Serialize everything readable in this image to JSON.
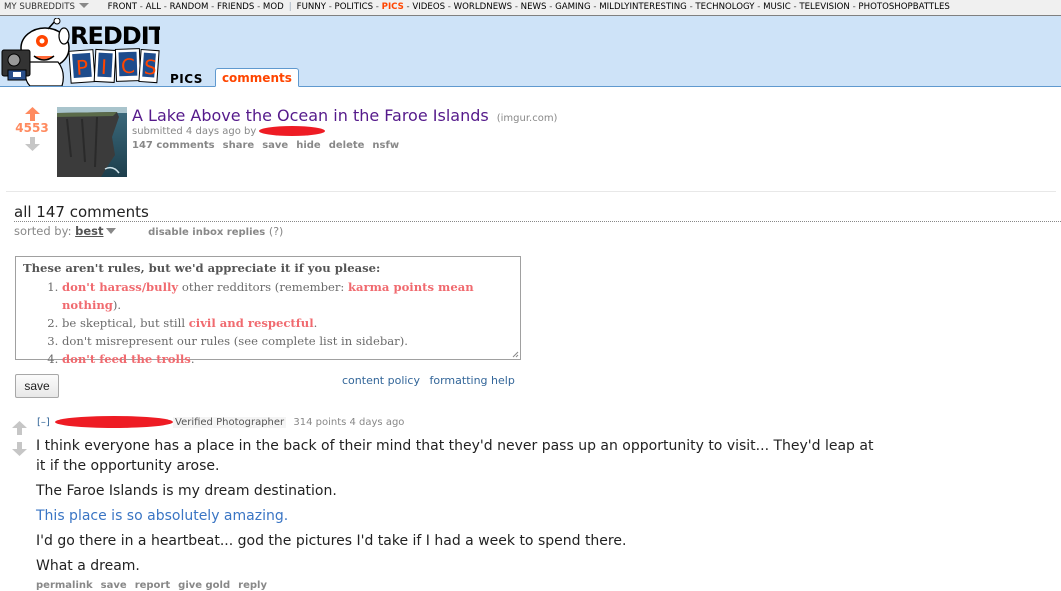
{
  "srbar": {
    "my_subreddits": "MY SUBREDDITS",
    "group1": [
      "FRONT",
      "ALL",
      "RANDOM",
      "FRIENDS",
      "MOD"
    ],
    "group2": [
      "FUNNY",
      "POLITICS",
      "PICS",
      "VIDEOS",
      "WORLDNEWS",
      "NEWS",
      "GAMING",
      "MILDLYINTERESTING",
      "TECHNOLOGY",
      "MUSIC",
      "TELEVISION",
      "PHOTOSHOPBATTLES"
    ],
    "selected": "PICS"
  },
  "header": {
    "logo_text_top": "REDDIT",
    "logo_text_bottom": "PICS",
    "tabs": [
      {
        "label": "PICS",
        "selected": false
      },
      {
        "label": "comments",
        "selected": true
      }
    ],
    "bg_color": "#cee3f8",
    "accent_color": "#ff4500"
  },
  "post": {
    "score": "4553",
    "title": "A Lake Above the Ocean in the Faroe Islands",
    "domain": "(imgur.com)",
    "submitted": "submitted 4 days ago by",
    "buttons": [
      "147 comments",
      "share",
      "save",
      "hide",
      "delete",
      "nsfw"
    ]
  },
  "comments_area": {
    "heading": "all 147 comments",
    "sorted_by_label": "sorted by:",
    "sort_value": "best",
    "disable_inbox": "disable inbox replies",
    "help_mark": "(?)"
  },
  "rules": {
    "heading": "These aren't rules, but we'd appreciate it if you please:",
    "items": [
      {
        "num": "1.",
        "parts": [
          {
            "t": "don't harass/bully",
            "hl": true
          },
          {
            "t": " other redditors (remember: ",
            "hl": false
          },
          {
            "t": "karma points mean nothing",
            "hl": true
          },
          {
            "t": ").",
            "hl": false
          }
        ]
      },
      {
        "num": "2.",
        "parts": [
          {
            "t": "be skeptical, but still ",
            "hl": false
          },
          {
            "t": "civil and respectful",
            "hl": true
          },
          {
            "t": ".",
            "hl": false
          }
        ]
      },
      {
        "num": "3.",
        "parts": [
          {
            "t": "don't misrepresent our rules (see complete list in sidebar).",
            "hl": false
          }
        ]
      },
      {
        "num": "4.",
        "parts": [
          {
            "t": "don't feed the trolls",
            "hl": true
          },
          {
            "t": ".",
            "hl": false
          }
        ]
      }
    ]
  },
  "form": {
    "save_label": "save",
    "content_policy": "content policy",
    "formatting_help": "formatting help"
  },
  "comment": {
    "expand": "[–]",
    "flair": "Verified Photographer",
    "meta": "314 points 4 days ago",
    "paragraphs": [
      {
        "text": "I think everyone has a place in the back of their mind that they'd never pass up an opportunity to visit... They'd leap at it if the opportunity arose.",
        "link": false
      },
      {
        "text": "The Faroe Islands is my dream destination.",
        "link": false
      },
      {
        "text": "This place is so absolutely amazing.",
        "link": true
      },
      {
        "text": "I'd go there in a heartbeat... god the pictures I'd take if I had a week to spend there.",
        "link": false
      },
      {
        "text": "What a dream.",
        "link": false
      }
    ],
    "actions": [
      "permalink",
      "save",
      "report",
      "give gold",
      "reply"
    ]
  }
}
